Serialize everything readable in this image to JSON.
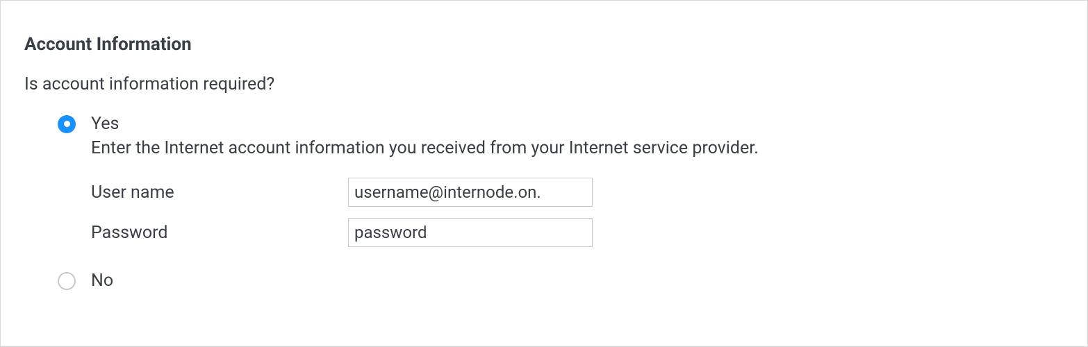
{
  "section": {
    "title": "Account Information",
    "question": "Is account information required?"
  },
  "radios": {
    "yes": {
      "label": "Yes",
      "selected": true
    },
    "no": {
      "label": "No",
      "selected": false
    }
  },
  "yesContent": {
    "instruction": "Enter the Internet account information you received from your Internet service provider.",
    "fields": {
      "username": {
        "label": "User name",
        "value": "username@internode.on."
      },
      "password": {
        "label": "Password",
        "value": "password"
      }
    }
  }
}
